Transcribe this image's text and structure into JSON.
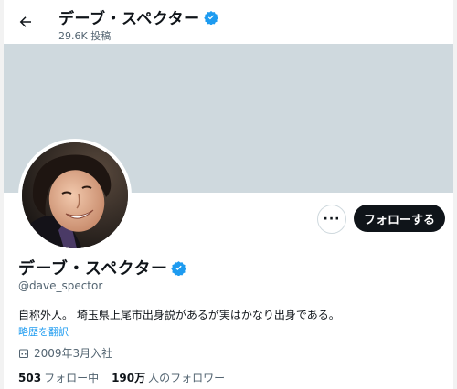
{
  "header": {
    "name": "デーブ・スペクター",
    "post_count": "29.6K 投稿"
  },
  "profile": {
    "display_name": "デーブ・スペクター",
    "handle": "@dave_spector",
    "bio": "自称外人。 埼玉県上尾市出身説があるが実はかなり出身である。",
    "translate_link": "略歴を翻訳",
    "joined": "2009年3月入社",
    "following_count": "503",
    "following_label": "フォロー中",
    "followers_count": "190万",
    "followers_label": "人のフォロワー"
  },
  "actions": {
    "more_label": "···",
    "follow_label": "フォローする"
  },
  "icons": {
    "back": "arrow-left-icon",
    "verified": "verified-badge-icon",
    "calendar": "calendar-icon"
  },
  "colors": {
    "accent": "#1d9bf0",
    "banner": "#cfd9de",
    "follow_button": "#0f1419"
  }
}
